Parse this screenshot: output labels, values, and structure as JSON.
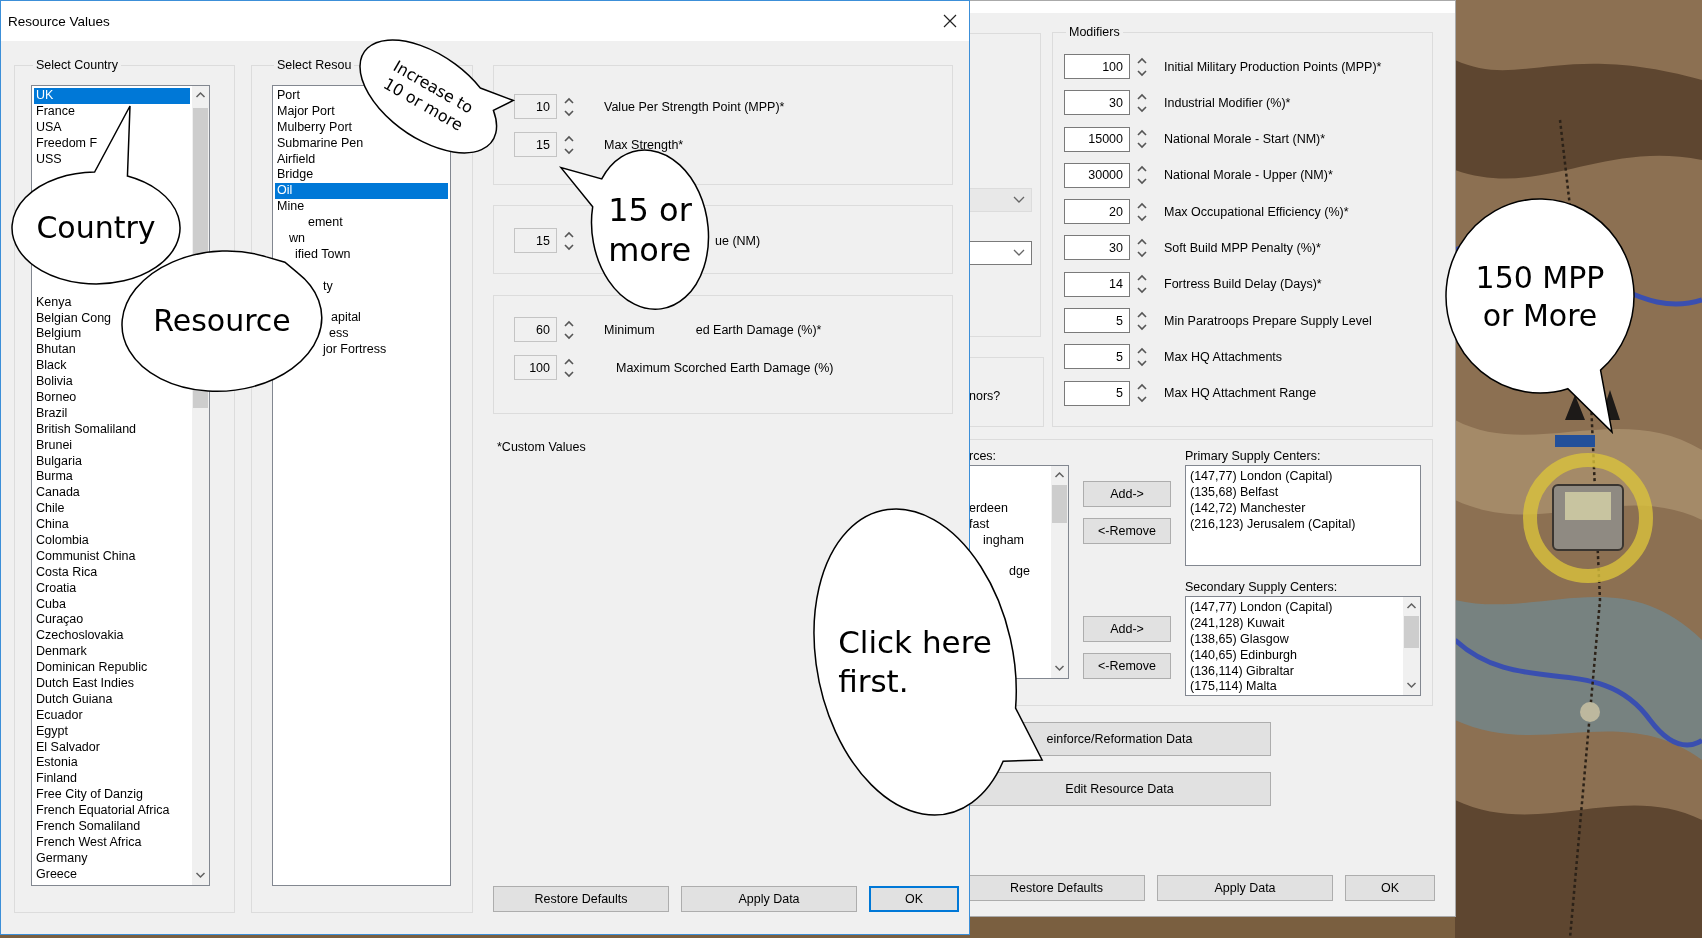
{
  "front_dialog": {
    "title": "Resource Values",
    "country_group": {
      "label": "Select Country",
      "items": [
        {
          "label": "UK",
          "selected": true
        },
        {
          "label": "France",
          "selected": false
        },
        {
          "label": "USA",
          "selected": false
        },
        {
          "label": "Freedom F",
          "selected": false
        },
        {
          "label": "USS",
          "selected": false
        },
        {
          "label": "Kenya",
          "selected": false
        },
        {
          "label": "Belgian Cong",
          "selected": false
        },
        {
          "label": "Belgium",
          "selected": false
        },
        {
          "label": "Bhutan",
          "selected": false
        },
        {
          "label": "Black",
          "selected": false
        },
        {
          "label": "Bolivia",
          "selected": false
        },
        {
          "label": "Borneo",
          "selected": false
        },
        {
          "label": "Brazil",
          "selected": false
        },
        {
          "label": "British Somaliland",
          "selected": false
        },
        {
          "label": "Brunei",
          "selected": false
        },
        {
          "label": "Bulgaria",
          "selected": false
        },
        {
          "label": "Burma",
          "selected": false
        },
        {
          "label": "Canada",
          "selected": false
        },
        {
          "label": "Chile",
          "selected": false
        },
        {
          "label": "China",
          "selected": false
        },
        {
          "label": "Colombia",
          "selected": false
        },
        {
          "label": "Communist China",
          "selected": false
        },
        {
          "label": "Costa Rica",
          "selected": false
        },
        {
          "label": "Croatia",
          "selected": false
        },
        {
          "label": "Cuba",
          "selected": false
        },
        {
          "label": "Curaçao",
          "selected": false
        },
        {
          "label": "Czechoslovakia",
          "selected": false
        },
        {
          "label": "Denmark",
          "selected": false
        },
        {
          "label": "Dominican Republic",
          "selected": false
        },
        {
          "label": "Dutch East Indies",
          "selected": false
        },
        {
          "label": "Dutch Guiana",
          "selected": false
        },
        {
          "label": "Ecuador",
          "selected": false
        },
        {
          "label": "Egypt",
          "selected": false
        },
        {
          "label": "El Salvador",
          "selected": false
        },
        {
          "label": "Estonia",
          "selected": false
        },
        {
          "label": "Finland",
          "selected": false
        },
        {
          "label": "Free City of Danzig",
          "selected": false
        },
        {
          "label": "French Equatorial Africa",
          "selected": false
        },
        {
          "label": "French Somaliland",
          "selected": false
        },
        {
          "label": "French West Africa",
          "selected": false
        },
        {
          "label": "Germany",
          "selected": false
        },
        {
          "label": "Greece",
          "selected": false
        }
      ]
    },
    "resource_group": {
      "label": "Select Resou",
      "items": [
        {
          "label": "Port",
          "selected": false
        },
        {
          "label": "Major Port",
          "selected": false
        },
        {
          "label": "Mulberry Port",
          "selected": false
        },
        {
          "label": "Submarine Pen",
          "selected": false
        },
        {
          "label": "Airfield",
          "selected": false
        },
        {
          "label": "Bridge",
          "selected": false
        },
        {
          "label": "Oil",
          "selected": true
        },
        {
          "label": "Mine",
          "selected": false
        },
        {
          "label": "ement",
          "selected": false
        },
        {
          "label": "wn",
          "selected": false
        },
        {
          "label": "ified Town",
          "selected": false
        },
        {
          "label": "ty",
          "selected": false
        },
        {
          "label": "apital",
          "selected": false
        },
        {
          "label": "ess",
          "selected": false
        },
        {
          "label": "jor Fortress",
          "selected": false
        }
      ]
    },
    "value_groups": [
      {
        "rows": [
          {
            "value": "10",
            "disabled": true,
            "label_parts": [
              "Value Per Strength Point (MPP)*"
            ]
          },
          {
            "value": "15",
            "disabled": true,
            "label_parts": [
              "Max Strength*"
            ]
          }
        ]
      },
      {
        "rows": [
          {
            "value": "15",
            "disabled": true,
            "label_parts": [
              "ue (NM)"
            ]
          }
        ]
      },
      {
        "rows": [
          {
            "value": "60",
            "disabled": true,
            "label_parts": [
              "Minimum",
              "ed Earth Damage (%)*"
            ]
          },
          {
            "value": "100",
            "disabled": true,
            "label_parts": [
              "Maximum Scorched Earth Damage (%)"
            ]
          }
        ]
      }
    ],
    "footnote": "*Custom Values",
    "buttons": [
      {
        "label": "Restore Defaults",
        "focused": false
      },
      {
        "label": "Apply Data",
        "focused": false
      },
      {
        "label": "OK",
        "focused": true
      }
    ]
  },
  "back_dialog": {
    "dropdowns": [
      {
        "disabled": true
      },
      {
        "disabled": false
      }
    ],
    "question_fragment": "nors?",
    "modifiers": {
      "label": "Modifiers",
      "rows": [
        {
          "value": "100",
          "disabled": false,
          "label": "Initial Military Production Points (MPP)*"
        },
        {
          "value": "30",
          "disabled": false,
          "label": "Industrial Modifier (%)*"
        },
        {
          "value": "15000",
          "disabled": false,
          "label": "National Morale - Start (NM)*"
        },
        {
          "value": "30000",
          "disabled": false,
          "label": "National Morale - Upper (NM)*"
        },
        {
          "value": "20",
          "disabled": false,
          "label": "Max Occupational Efficiency (%)*"
        },
        {
          "value": "30",
          "disabled": false,
          "label": "Soft Build MPP Penalty (%)*"
        },
        {
          "value": "14",
          "disabled": false,
          "label": "Fortress Build Delay (Days)*"
        },
        {
          "value": "5",
          "disabled": false,
          "label": "Min Paratroops Prepare Supply Level"
        },
        {
          "value": "5",
          "disabled": false,
          "label": "Max HQ Attachments"
        },
        {
          "value": "5",
          "disabled": false,
          "label": "Max HQ Attachment Range"
        }
      ]
    },
    "sources": {
      "label": "rces:",
      "items": [
        "erdeen",
        "fast",
        "ingham",
        "dge"
      ]
    },
    "primary": {
      "label": "Primary Supply Centers:",
      "items": [
        "(147,77) London (Capital)",
        "(135,68) Belfast",
        "(142,72) Manchester",
        "(216,123) Jerusalem (Capital)"
      ],
      "buttons": [
        "Add->",
        "<-Remove"
      ]
    },
    "secondary": {
      "label": "Secondary Supply Centers:",
      "items": [
        "(147,77) London (Capital)",
        "(241,128) Kuwait",
        "(138,65) Glasgow",
        "(140,65) Edinburgh",
        "(136,114) Gibraltar",
        "(175,114) Malta"
      ],
      "buttons": [
        "Add->",
        "<-Remove"
      ]
    },
    "data_buttons": [
      "einforce/Reformation Data",
      "Edit Resource Data"
    ],
    "buttons": [
      {
        "label": "Restore Defaults",
        "focused": false
      },
      {
        "label": "Apply Data",
        "focused": false
      },
      {
        "label": "OK",
        "focused": false
      }
    ]
  },
  "callouts": [
    {
      "text": "Country"
    },
    {
      "text": "Resource"
    },
    {
      "text": "Increase to\n10 or more"
    },
    {
      "text": "15 or\nmore"
    },
    {
      "text": "Click here\nfirst."
    },
    {
      "text": "150 MPP\nor More"
    }
  ]
}
